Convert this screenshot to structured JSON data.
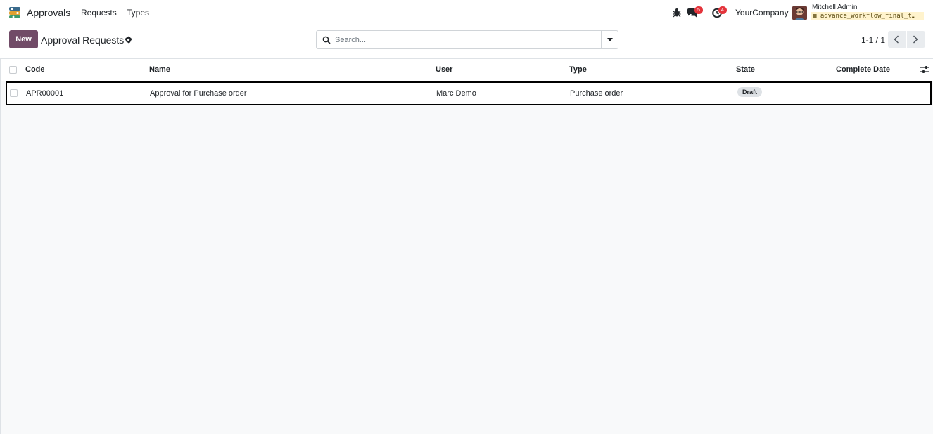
{
  "navbar": {
    "app_name": "Approvals",
    "menu": [
      {
        "label": "Requests"
      },
      {
        "label": "Types"
      }
    ],
    "messages_badge": "5",
    "activities_badge": "4",
    "company": "YourCompany",
    "user_name": "Mitchell Admin",
    "database": "advance_workflow_final_t…"
  },
  "control_panel": {
    "new_label": "New",
    "title": "Approval Requests",
    "search_placeholder": "Search...",
    "pager": "1-1 / 1"
  },
  "list": {
    "columns": [
      "Code",
      "Name",
      "User",
      "Type",
      "State",
      "Complete Date"
    ],
    "rows": [
      {
        "code": "APR00001",
        "name": "Approval for Purchase order",
        "user": "Marc Demo",
        "type": "Purchase order",
        "state": "Draft",
        "complete_date": ""
      }
    ]
  },
  "colors": {
    "brand": "#714b67",
    "badge": "#e4343b",
    "background": "#f8f9fa"
  }
}
